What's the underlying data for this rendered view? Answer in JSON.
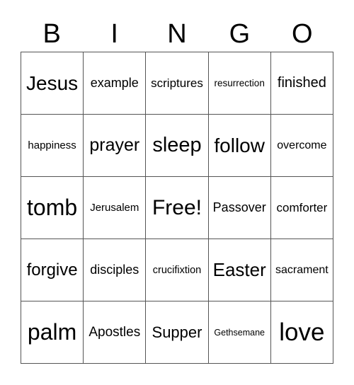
{
  "header": [
    "B",
    "I",
    "N",
    "G",
    "O"
  ],
  "cells": [
    "Jesus",
    "example",
    "scriptures",
    "resurrection",
    "finished",
    "happiness",
    "prayer",
    "sleep",
    "follow",
    "overcome",
    "tomb",
    "Jerusalem",
    "Free!",
    "Passover",
    "comforter",
    "forgive",
    "disciples",
    "crucifixtion",
    "Easter",
    "sacrament",
    "palm",
    "Apostles",
    "Supper",
    "Gethsemane",
    "love"
  ]
}
